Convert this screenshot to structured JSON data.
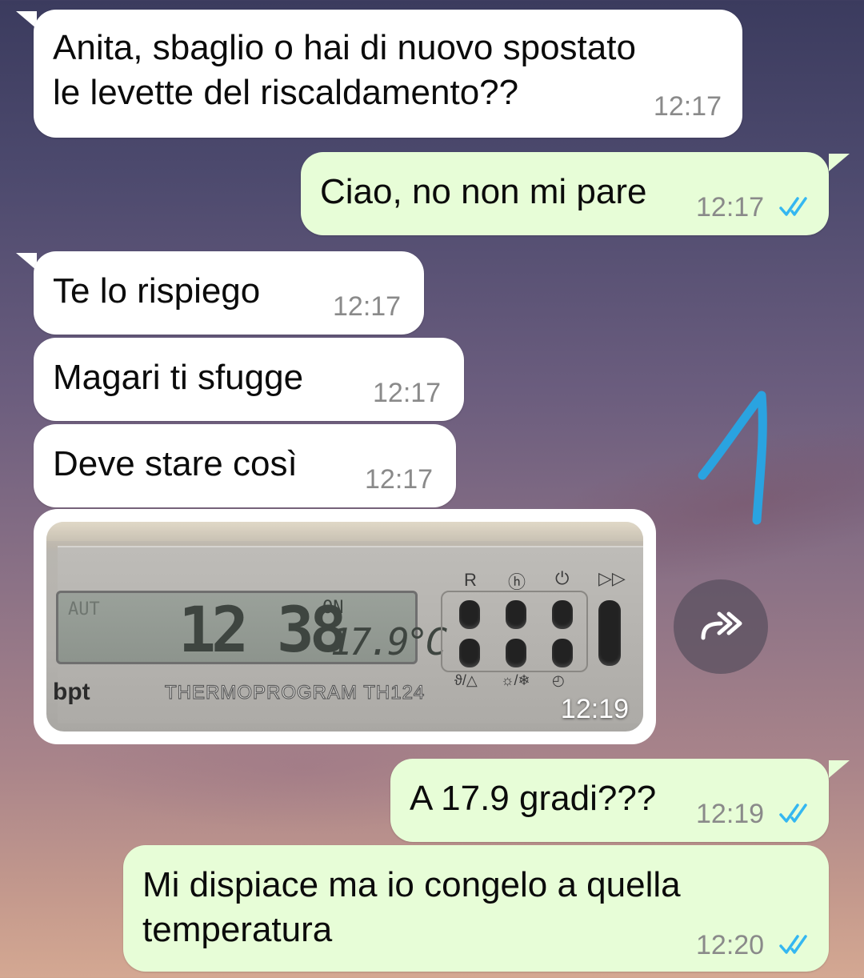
{
  "messages": [
    {
      "id": "m1",
      "dir": "in",
      "text": "Anita, sbaglio o hai di nuovo spostato\nle levette del riscaldamento??",
      "time": "12:17"
    },
    {
      "id": "m2",
      "dir": "out",
      "text": "Ciao, no non mi pare",
      "time": "12:17",
      "status": "read"
    },
    {
      "id": "m3",
      "dir": "in",
      "text": "Te lo rispiego",
      "time": "12:17"
    },
    {
      "id": "m4",
      "dir": "in",
      "text": "Magari ti sfugge",
      "time": "12:17"
    },
    {
      "id": "m5",
      "dir": "in",
      "text": "Deve stare così",
      "time": "12:17"
    },
    {
      "id": "m6",
      "dir": "in",
      "type": "image",
      "time": "12:19",
      "photo": {
        "lcd_mode": "AUT",
        "lcd_clock": "12 38",
        "lcd_on": "ON",
        "lcd_temp": "17.9°C",
        "button_top_labels": [
          "R",
          "ⓗ",
          "⏻",
          "▷▷"
        ],
        "button_bottom_labels": [
          "ϑ/△",
          "☼/❄",
          "◴"
        ],
        "brand": "bpt",
        "model": "THERMOPROGRAM TH124"
      }
    },
    {
      "id": "m7",
      "dir": "out",
      "text": "A 17.9 gradi???",
      "time": "12:19",
      "status": "read"
    },
    {
      "id": "m8",
      "dir": "out",
      "text": "Mi dispiace ma io congelo a quella\ntemperatura",
      "time": "12:20",
      "status": "read"
    }
  ],
  "forward_icon": "forward-icon",
  "annotation": "hand-drawn-arrow",
  "colors": {
    "incoming": "#ffffff",
    "outgoing": "#e7fdd7",
    "read_ticks": "#34b7f1",
    "time": "#8a8a8a",
    "scribble": "#2aa3e0"
  }
}
